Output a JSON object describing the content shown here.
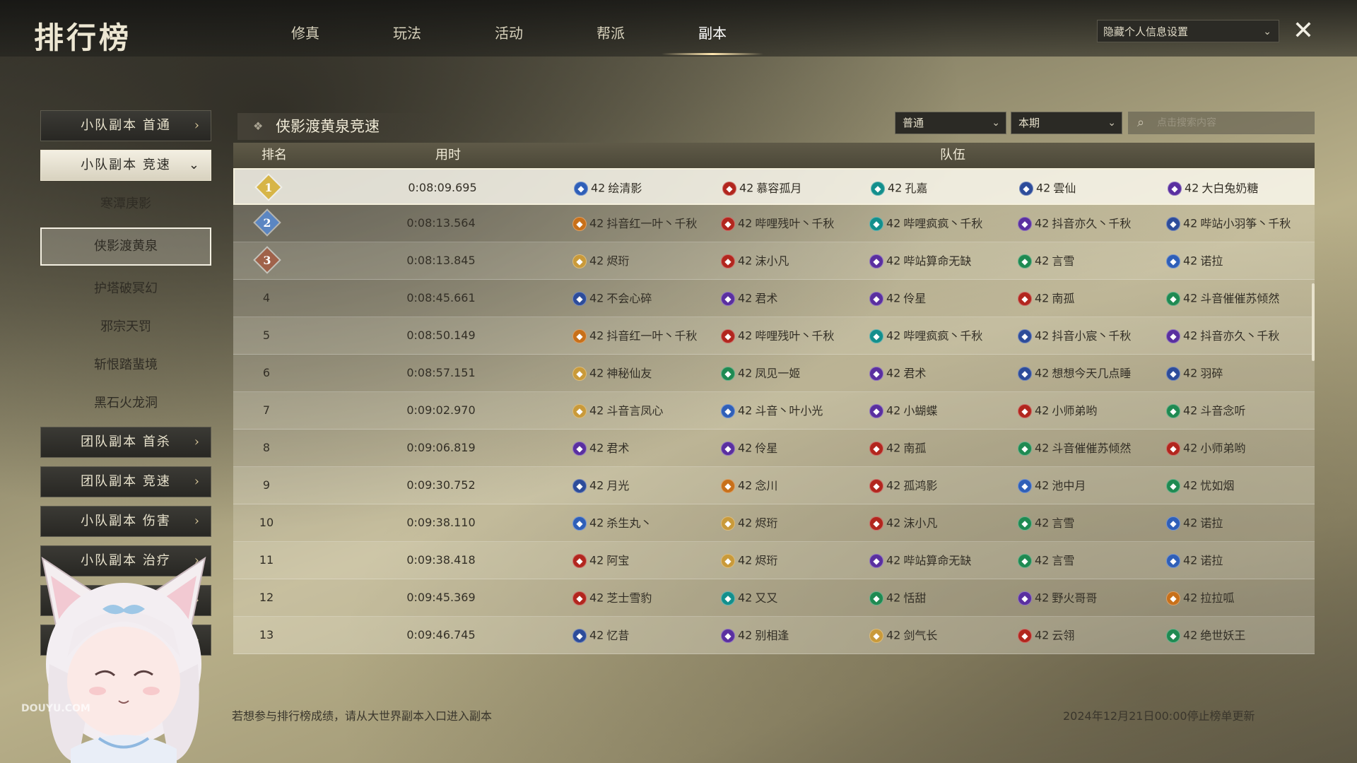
{
  "app": {
    "title": "排行榜"
  },
  "tabs": [
    {
      "label": "修真",
      "active": false
    },
    {
      "label": "玩法",
      "active": false
    },
    {
      "label": "活动",
      "active": false
    },
    {
      "label": "帮派",
      "active": false
    },
    {
      "label": "副本",
      "active": true
    }
  ],
  "privacy_select": {
    "value": "隐藏个人信息设置"
  },
  "sidebar": {
    "items": [
      {
        "label": "小队副本 首通",
        "type": "category",
        "expanded": false
      },
      {
        "label": "小队副本 竞速",
        "type": "category",
        "expanded": true
      },
      {
        "label": "寒潭庚影",
        "type": "sub",
        "selected": false
      },
      {
        "label": "侠影渡黄泉",
        "type": "sub",
        "selected": true
      },
      {
        "label": "护塔破冥幻",
        "type": "sub",
        "selected": false
      },
      {
        "label": "邪宗天罚",
        "type": "sub",
        "selected": false
      },
      {
        "label": "斩恨踏蜚境",
        "type": "sub",
        "selected": false
      },
      {
        "label": "黑石火龙洞",
        "type": "sub",
        "selected": false
      },
      {
        "label": "团队副本 首杀",
        "type": "category",
        "expanded": false
      },
      {
        "label": "团队副本 竞速",
        "type": "category",
        "expanded": false
      },
      {
        "label": "小队副本 伤害",
        "type": "category",
        "expanded": false
      },
      {
        "label": "小队副本 治疗",
        "type": "category",
        "expanded": false
      },
      {
        "label": "",
        "type": "category",
        "expanded": false
      },
      {
        "label": "",
        "type": "category",
        "expanded": false
      }
    ]
  },
  "section": {
    "title": "侠影渡黄泉竞速"
  },
  "filters": {
    "difficulty": "普通",
    "period": "本期",
    "search_placeholder": "点击搜索内容"
  },
  "table": {
    "headers": {
      "rank": "排名",
      "time": "用时",
      "team": "队伍"
    },
    "rows": [
      {
        "rank": "1",
        "time": "0:08:09.695",
        "members": [
          {
            "cls": "blue",
            "level": "42",
            "name": "绘清影"
          },
          {
            "cls": "red",
            "level": "42",
            "name": "慕容孤月"
          },
          {
            "cls": "teal",
            "level": "42",
            "name": "孔嘉"
          },
          {
            "cls": "navy",
            "level": "42",
            "name": "雲仙"
          },
          {
            "cls": "purple",
            "level": "42",
            "name": "大白兔奶糖"
          }
        ]
      },
      {
        "rank": "2",
        "time": "0:08:13.564",
        "members": [
          {
            "cls": "orange",
            "level": "42",
            "name": "抖音红一叶丶千秋"
          },
          {
            "cls": "red",
            "level": "42",
            "name": "哔哩残叶丶千秋"
          },
          {
            "cls": "teal",
            "level": "42",
            "name": "哔哩疯疯丶千秋"
          },
          {
            "cls": "purple",
            "level": "42",
            "name": "抖音亦久丶千秋"
          },
          {
            "cls": "navy",
            "level": "42",
            "name": "哔站小羽筝丶千秋"
          }
        ]
      },
      {
        "rank": "3",
        "time": "0:08:13.845",
        "members": [
          {
            "cls": "gold",
            "level": "42",
            "name": "烬珩"
          },
          {
            "cls": "red",
            "level": "42",
            "name": "沫小凡"
          },
          {
            "cls": "purple",
            "level": "42",
            "name": "哔站算命无缺"
          },
          {
            "cls": "green",
            "level": "42",
            "name": "言雪"
          },
          {
            "cls": "blue",
            "level": "42",
            "name": "诺拉"
          }
        ]
      },
      {
        "rank": "4",
        "time": "0:08:45.661",
        "members": [
          {
            "cls": "navy",
            "level": "42",
            "name": "不会心碎"
          },
          {
            "cls": "purple",
            "level": "42",
            "name": "君术"
          },
          {
            "cls": "purple",
            "level": "42",
            "name": "伶星"
          },
          {
            "cls": "red",
            "level": "42",
            "name": "南孤"
          },
          {
            "cls": "green",
            "level": "42",
            "name": "斗音催催苏倾然"
          }
        ]
      },
      {
        "rank": "5",
        "time": "0:08:50.149",
        "members": [
          {
            "cls": "orange",
            "level": "42",
            "name": "抖音红一叶丶千秋"
          },
          {
            "cls": "red",
            "level": "42",
            "name": "哔哩残叶丶千秋"
          },
          {
            "cls": "teal",
            "level": "42",
            "name": "哔哩疯疯丶千秋"
          },
          {
            "cls": "navy",
            "level": "42",
            "name": "抖音小宸丶千秋"
          },
          {
            "cls": "purple",
            "level": "42",
            "name": "抖音亦久丶千秋"
          }
        ]
      },
      {
        "rank": "6",
        "time": "0:08:57.151",
        "members": [
          {
            "cls": "gold",
            "level": "42",
            "name": "神秘仙友"
          },
          {
            "cls": "green",
            "level": "42",
            "name": "凤见一姬"
          },
          {
            "cls": "purple",
            "level": "42",
            "name": "君术"
          },
          {
            "cls": "navy",
            "level": "42",
            "name": "想想今天几点睡"
          },
          {
            "cls": "navy",
            "level": "42",
            "name": "羽碎"
          }
        ]
      },
      {
        "rank": "7",
        "time": "0:09:02.970",
        "members": [
          {
            "cls": "gold",
            "level": "42",
            "name": "斗音言凤心"
          },
          {
            "cls": "blue",
            "level": "42",
            "name": "斗音丶叶小光"
          },
          {
            "cls": "purple",
            "level": "42",
            "name": "小蝴蝶"
          },
          {
            "cls": "red",
            "level": "42",
            "name": "小师弟哟"
          },
          {
            "cls": "green",
            "level": "42",
            "name": "斗音念听"
          }
        ]
      },
      {
        "rank": "8",
        "time": "0:09:06.819",
        "members": [
          {
            "cls": "purple",
            "level": "42",
            "name": "君术"
          },
          {
            "cls": "purple",
            "level": "42",
            "name": "伶星"
          },
          {
            "cls": "red",
            "level": "42",
            "name": "南孤"
          },
          {
            "cls": "green",
            "level": "42",
            "name": "斗音催催苏倾然"
          },
          {
            "cls": "red",
            "level": "42",
            "name": "小师弟哟"
          }
        ]
      },
      {
        "rank": "9",
        "time": "0:09:30.752",
        "members": [
          {
            "cls": "navy",
            "level": "42",
            "name": "月光"
          },
          {
            "cls": "orange",
            "level": "42",
            "name": "念川"
          },
          {
            "cls": "red",
            "level": "42",
            "name": "孤鸿影"
          },
          {
            "cls": "blue",
            "level": "42",
            "name": "池中月"
          },
          {
            "cls": "green",
            "level": "42",
            "name": "忧如烟"
          }
        ]
      },
      {
        "rank": "10",
        "time": "0:09:38.110",
        "members": [
          {
            "cls": "blue",
            "level": "42",
            "name": "杀生丸丶"
          },
          {
            "cls": "gold",
            "level": "42",
            "name": "烬珩"
          },
          {
            "cls": "red",
            "level": "42",
            "name": "沫小凡"
          },
          {
            "cls": "green",
            "level": "42",
            "name": "言雪"
          },
          {
            "cls": "blue",
            "level": "42",
            "name": "诺拉"
          }
        ]
      },
      {
        "rank": "11",
        "time": "0:09:38.418",
        "members": [
          {
            "cls": "red",
            "level": "42",
            "name": "阿宝"
          },
          {
            "cls": "gold",
            "level": "42",
            "name": "烬珩"
          },
          {
            "cls": "purple",
            "level": "42",
            "name": "哔站算命无缺"
          },
          {
            "cls": "green",
            "level": "42",
            "name": "言雪"
          },
          {
            "cls": "blue",
            "level": "42",
            "name": "诺拉"
          }
        ]
      },
      {
        "rank": "12",
        "time": "0:09:45.369",
        "members": [
          {
            "cls": "red",
            "level": "42",
            "name": "芝士雪豹"
          },
          {
            "cls": "teal",
            "level": "42",
            "name": "又又"
          },
          {
            "cls": "green",
            "level": "42",
            "name": "恬甜"
          },
          {
            "cls": "purple",
            "level": "42",
            "name": "野火哥哥"
          },
          {
            "cls": "orange",
            "level": "42",
            "name": "拉拉呱"
          }
        ]
      },
      {
        "rank": "13",
        "time": "0:09:46.745",
        "members": [
          {
            "cls": "navy",
            "level": "42",
            "name": "忆昔"
          },
          {
            "cls": "purple",
            "level": "42",
            "name": "别相逢"
          },
          {
            "cls": "gold",
            "level": "42",
            "name": "剑气长"
          },
          {
            "cls": "red",
            "level": "42",
            "name": "云翎"
          },
          {
            "cls": "green",
            "level": "42",
            "name": "绝世妖王"
          }
        ]
      }
    ]
  },
  "footer": {
    "hint": "若想参与排行榜成绩，请从大世界副本入口进入副本",
    "stop_time": "2024年12月21日00:00停止榜单更新"
  },
  "colors": {
    "blue": "#2f5fb8",
    "red": "#b2261e",
    "teal": "#138f8c",
    "navy": "#2d4c9a",
    "purple": "#5a2fa0",
    "orange": "#c8701a",
    "gold": "#c99a3a",
    "green": "#1f8a52",
    "rank1": "#d7b547",
    "rank2": "#5b86c2",
    "rank3": "#a0624a"
  },
  "icons": {
    "close": "close-icon",
    "search": "search-icon",
    "chevron": "chevron-down-icon",
    "arrow": "chevron-right-icon"
  }
}
